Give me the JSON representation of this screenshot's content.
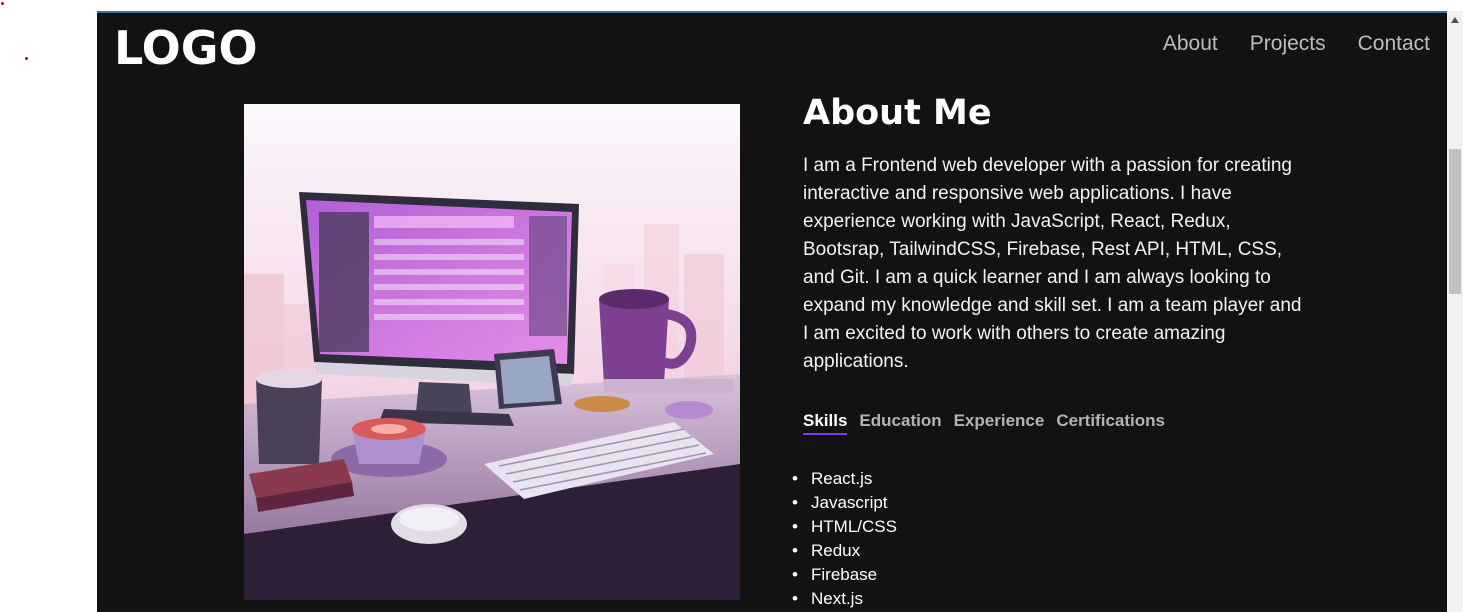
{
  "header": {
    "logo": "LOGO",
    "nav": [
      "About",
      "Projects",
      "Contact"
    ]
  },
  "hero": {
    "image": "illustration-desk-computer-purple"
  },
  "about": {
    "title": "About Me",
    "paragraph": "I am a Frontend web developer with a passion for creating interactive and responsive web applications. I have experience working with JavaScript, React, Redux, Bootsrap, TailwindCSS, Firebase, Rest API, HTML, CSS, and Git. I am a quick learner and I am always looking to expand my knowledge and skill set. I am a team player and I am excited to work with others to create amazing applications."
  },
  "tabs": {
    "items": [
      "Skills",
      "Education",
      "Experience",
      "Certifications"
    ],
    "active": "Skills"
  },
  "skills": [
    "React.js",
    "Javascript",
    "HTML/CSS",
    "Redux",
    "Firebase",
    "Next.js"
  ],
  "colors": {
    "background": "#121212",
    "accent": "#7b3fe4",
    "text": "#ffffff",
    "muted": "#bdbdbd"
  }
}
